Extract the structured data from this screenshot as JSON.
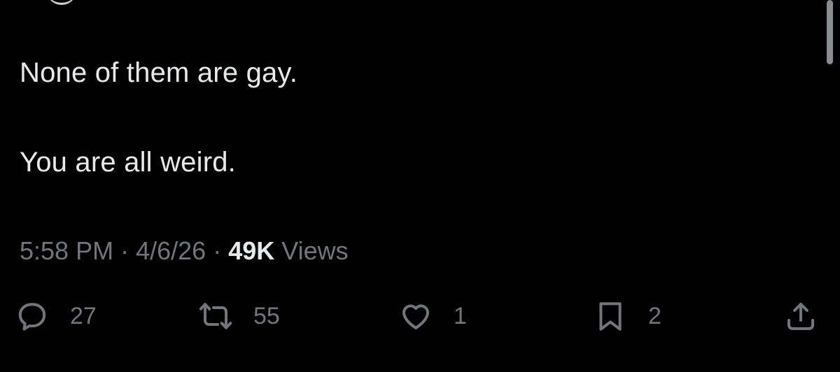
{
  "tweet": {
    "lines": [
      "None of them are gay.",
      "You are all weird."
    ]
  },
  "meta": {
    "time": "5:58 PM",
    "separator": "·",
    "date": "4/6/26",
    "views_count": "49K",
    "views_label": "Views"
  },
  "actions": {
    "replies": "27",
    "reposts": "55",
    "likes": "1",
    "bookmarks": "2"
  },
  "icons": {
    "reply": "reply-icon",
    "repost": "repost-icon",
    "like": "heart-icon",
    "bookmark": "bookmark-icon",
    "share": "share-icon"
  },
  "colors": {
    "background": "#000000",
    "text": "#e7e9ea",
    "secondary": "#71767b"
  }
}
